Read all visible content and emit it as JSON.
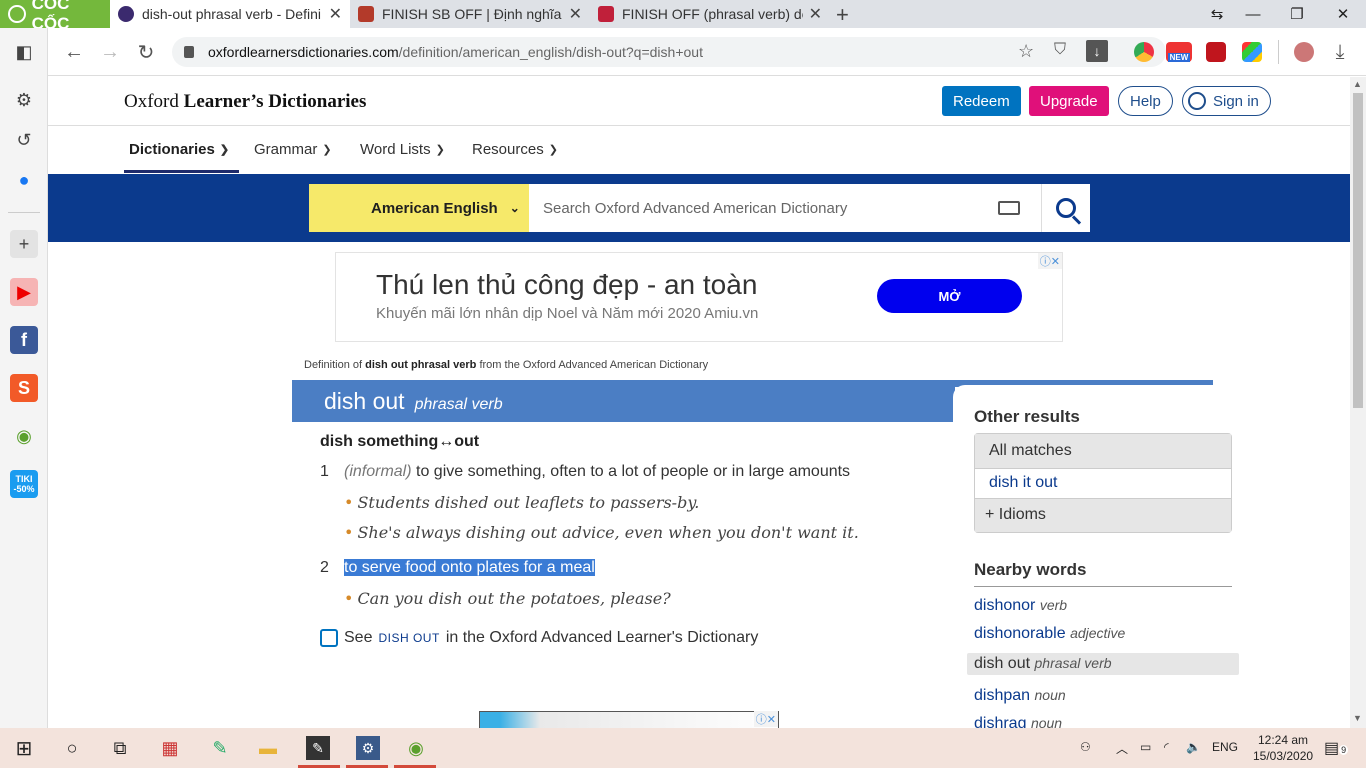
{
  "browser": {
    "coccoc_label": "CỐC CỐC",
    "tabs": [
      {
        "title": "dish-out phrasal verb - Defini"
      },
      {
        "title": "FINISH SB OFF | Định nghĩa tr"
      },
      {
        "title": "FINISH OFF (phrasal verb) def"
      }
    ],
    "url_domain": "oxfordlearnersdictionaries.com",
    "url_path": "/definition/american_english/dish-out?q=dish+out",
    "new_badge": "NEW"
  },
  "sidebar": {
    "tiki_badge": "-50%",
    "tiki_label": "TIKI"
  },
  "header": {
    "logo_light": "Oxford ",
    "logo_bold": "Learner’s Dictionaries",
    "redeem": "Redeem",
    "upgrade": "Upgrade",
    "help": "Help",
    "signin": "Sign in"
  },
  "menu": {
    "dictionaries": "Dictionaries",
    "grammar": "Grammar",
    "wordlists": "Word Lists",
    "resources": "Resources"
  },
  "search": {
    "language": "American English",
    "placeholder": "Search Oxford Advanced American Dictionary"
  },
  "ad": {
    "headline": "Thú len thủ công đẹp - an toàn",
    "sub": "Khuyến mãi lớn nhân dịp Noel và Năm mới 2020 Amiu.vn",
    "cta": "MỞ",
    "choice": "ⓘ✕"
  },
  "entry": {
    "defline_pre": "Definition of ",
    "defline_bold": "dish out phrasal verb",
    "defline_post": " from the Oxford Advanced American Dictionary",
    "headword": "dish out",
    "pos": "phrasal verb",
    "pattern": "dish something↔out",
    "sense1_num": "1",
    "sense1_label": "(informal)",
    "sense1_def": " to give something, often to a lot of people or in large amounts",
    "ex1": "Students dished out leaflets to passers-by.",
    "ex2": "She's always dishing out advice, even when you don't want it.",
    "sense2_num": "2",
    "sense2_def": "to serve food onto plates for a meal",
    "ex3": "Can you dish out the potatoes, please?",
    "see_pre": "See ",
    "see_sc": "DISH OUT",
    "see_post": " in the Oxford Advanced Learner's Dictionary"
  },
  "other_results": {
    "title": "Other results",
    "all_matches": "All matches",
    "item1": "dish it out",
    "idioms": "Idioms"
  },
  "nearby": {
    "title": "Nearby words",
    "words": [
      {
        "w": "dishonor",
        "p": "verb"
      },
      {
        "w": "dishonorable",
        "p": "adjective"
      },
      {
        "w": "dish out",
        "p": "phrasal verb"
      },
      {
        "w": "dishpan",
        "p": "noun"
      },
      {
        "w": "dishrag",
        "p": "noun"
      }
    ]
  },
  "taskbar": {
    "lang": "ENG",
    "time": "12:24 am",
    "date": "15/03/2020",
    "notif_count": "9"
  }
}
